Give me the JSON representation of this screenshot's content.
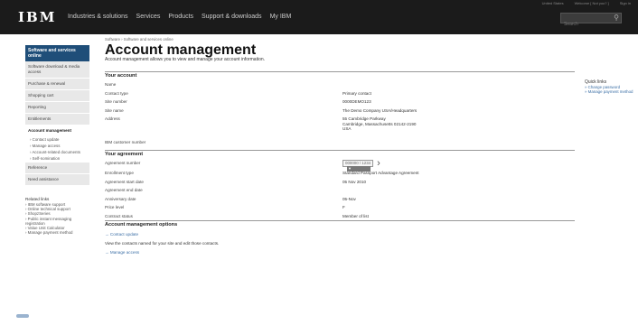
{
  "topbar": {
    "logo": "IBM",
    "util_links": [
      "United States",
      "Welcome [ Not you? ]",
      "Sign in"
    ],
    "nav": [
      "Industries & solutions",
      "Services",
      "Products",
      "Support & downloads",
      "My IBM"
    ],
    "search_placeholder": "Search"
  },
  "sidebar": {
    "header": "Software and services online",
    "items": [
      {
        "label": "Software download & media access"
      },
      {
        "label": "Purchase & renewal"
      },
      {
        "label": "Shopping cart"
      },
      {
        "label": "Reporting"
      },
      {
        "label": "Entitlements"
      },
      {
        "label": "Account management"
      }
    ],
    "sub_items": [
      "› Contact update",
      "› Manage access",
      "› Account-related documents",
      "› Self-nomination"
    ],
    "after_items": [
      {
        "label": "Reference"
      },
      {
        "label": "Need assistance"
      }
    ],
    "related_title": "Related links",
    "related_links": [
      "› IBM software support",
      "› Online technical support",
      "› ShopzSeries",
      "› Public instant messaging registration",
      "› Value Unit Calculator",
      "› Manage payment method"
    ]
  },
  "main": {
    "breadcrumb": "Software › Software and services online",
    "title": "Account management",
    "description": "Account management allows you to view and manage your account information.",
    "your_account": {
      "title": "Your account",
      "rows": [
        {
          "label": "Name",
          "value": ""
        },
        {
          "label": "Contact type",
          "value": "Primary contact"
        },
        {
          "label": "Site number",
          "value": "0000DEMO123"
        },
        {
          "label": "Site name",
          "value": "The Demo Company USA/Headquarters"
        },
        {
          "label": "Address",
          "lines": [
            "55 Cambridge Parkway",
            "Cambridge, Massachusetts 02142-2190",
            "USA"
          ]
        },
        {
          "label": "IBM customer number",
          "value": ""
        }
      ]
    },
    "your_agreement": {
      "title": "Your agreement",
      "agreement_number_label": "Agreement number",
      "agreement_number_value": "000000 / 1234",
      "rows": [
        {
          "label": "Enrollment type",
          "value": "Standard Passport Advantage Agreement"
        },
        {
          "label": "Agreement start date",
          "value": "05 Nov 2010"
        },
        {
          "label": "Agreement end date",
          "value": ""
        },
        {
          "label": "Anniversary date",
          "value": "05-Nov"
        },
        {
          "label": "Price level",
          "value": "F"
        },
        {
          "label": "Contract status",
          "value": "Member of list"
        }
      ]
    },
    "options": {
      "title": "Account management options",
      "contact_update_link": "→ Contact update",
      "contact_text": "View the contacts named for your site and edit those contacts.",
      "manage_access_link": "→ Manage access"
    }
  },
  "quicklinks": {
    "title": "Quick links",
    "links": [
      "» Change password",
      "» Manage payment method"
    ]
  },
  "colors": {
    "sidebar_header": "#1f4e79",
    "link": "#3a6ea5",
    "topbar": "#1b1b1b"
  }
}
